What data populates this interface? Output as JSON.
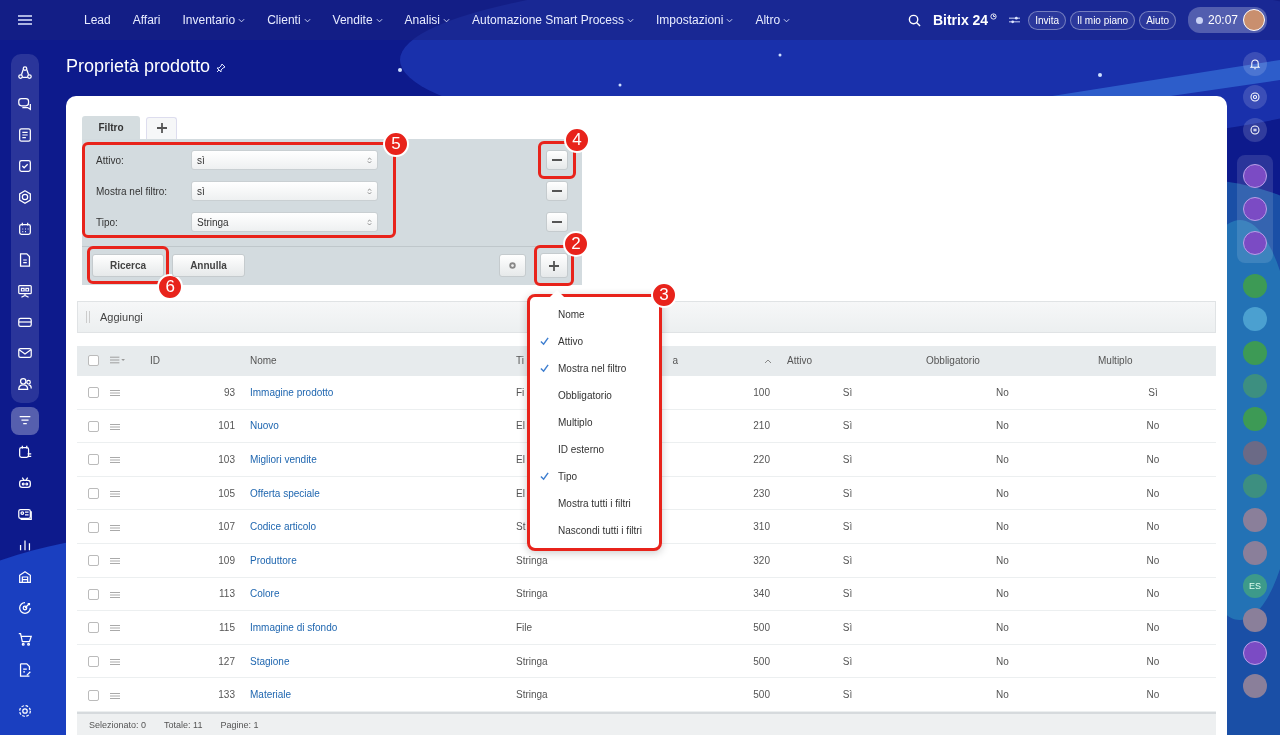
{
  "topbar": {
    "menu": [
      {
        "label": "Lead",
        "has_caret": false
      },
      {
        "label": "Affari",
        "has_caret": false
      },
      {
        "label": "Inventario",
        "has_caret": true
      },
      {
        "label": "Clienti",
        "has_caret": true
      },
      {
        "label": "Vendite",
        "has_caret": true
      },
      {
        "label": "Analisi",
        "has_caret": true
      },
      {
        "label": "Automazione Smart Process",
        "has_caret": true
      },
      {
        "label": "Impostazioni",
        "has_caret": true
      },
      {
        "label": "Altro",
        "has_caret": true
      }
    ],
    "brand": "Bitrix 24",
    "buttons": [
      "Invita",
      "Il mio piano",
      "Aiuto"
    ],
    "time": "20:07"
  },
  "sidebar": {
    "items": [
      {
        "selected": false
      },
      {
        "selected": false
      },
      {
        "selected": false
      },
      {
        "selected": false
      },
      {
        "selected": false
      },
      {
        "selected": false
      },
      {
        "selected": false
      },
      {
        "selected": false
      },
      {
        "selected": false
      },
      {
        "selected": false
      },
      {
        "selected": false
      },
      {
        "selected": true
      },
      {
        "selected": false
      },
      {
        "selected": false
      },
      {
        "selected": false
      },
      {
        "selected": false
      },
      {
        "selected": false
      },
      {
        "selected": false
      },
      {
        "selected": false
      },
      {
        "selected": false
      }
    ]
  },
  "page": {
    "title": "Proprietà prodotto"
  },
  "filter": {
    "tab": {
      "label": "Filtro",
      "selected": true
    },
    "callout": "5",
    "fields": [
      {
        "label": "Attivo:",
        "value": "sì",
        "callout": "4"
      },
      {
        "label": "Mostra nel filtro:",
        "value": "sì"
      },
      {
        "label": "Tipo:",
        "value": "Stringa"
      }
    ],
    "buttons": [
      {
        "label": "Ricerca",
        "callout": "6"
      },
      {
        "label": "Annulla"
      }
    ],
    "add_callout": "2"
  },
  "field_menu": {
    "callout": "3",
    "items": [
      {
        "label": "Nome",
        "checked": false
      },
      {
        "label": "Attivo",
        "checked": true
      },
      {
        "label": "Mostra nel filtro",
        "checked": true
      },
      {
        "label": "Obbligatorio",
        "checked": false
      },
      {
        "label": "Multiplo",
        "checked": false
      },
      {
        "label": "ID esterno",
        "checked": false
      },
      {
        "label": "Tipo",
        "checked": true
      },
      {
        "label": "Mostra tutti i filtri",
        "checked": false
      },
      {
        "label": "Nascondi tutti i filtri",
        "checked": false
      }
    ]
  },
  "toolbar": {
    "label": "Aggiungi"
  },
  "table": {
    "select_all": {
      "checked": false
    },
    "columns": [
      "ID",
      "Nome",
      "Ti",
      "a",
      "Attivo",
      "Obbligatorio",
      "Multiplo"
    ],
    "rows": [
      {
        "id": "93",
        "name": "Immagine prodotto",
        "type": "Fi",
        "sort": "100",
        "active": "Sì",
        "required": "No",
        "multiple": "Sì",
        "selected": false
      },
      {
        "id": "101",
        "name": "Nuovo",
        "type": "El",
        "sort": "210",
        "active": "Sì",
        "required": "No",
        "multiple": "No",
        "selected": false
      },
      {
        "id": "103",
        "name": "Migliori vendite",
        "type": "El",
        "sort": "220",
        "active": "Sì",
        "required": "No",
        "multiple": "No",
        "selected": false
      },
      {
        "id": "105",
        "name": "Offerta speciale",
        "type": "El",
        "sort": "230",
        "active": "Sì",
        "required": "No",
        "multiple": "No",
        "selected": false
      },
      {
        "id": "107",
        "name": "Codice articolo",
        "type": "St",
        "sort": "310",
        "active": "Sì",
        "required": "No",
        "multiple": "No",
        "selected": false
      },
      {
        "id": "109",
        "name": "Produttore",
        "type": "Stringa",
        "sort": "320",
        "active": "Sì",
        "required": "No",
        "multiple": "No",
        "selected": false
      },
      {
        "id": "113",
        "name": "Colore",
        "type": "Stringa",
        "sort": "340",
        "active": "Sì",
        "required": "No",
        "multiple": "No",
        "selected": false
      },
      {
        "id": "115",
        "name": "Immagine di sfondo",
        "type": "File",
        "sort": "500",
        "active": "Sì",
        "required": "No",
        "multiple": "No",
        "selected": false
      },
      {
        "id": "127",
        "name": "Stagione",
        "type": "Stringa",
        "sort": "500",
        "active": "Sì",
        "required": "No",
        "multiple": "No",
        "selected": false
      },
      {
        "id": "133",
        "name": "Materiale",
        "type": "Stringa",
        "sort": "500",
        "active": "Sì",
        "required": "No",
        "multiple": "No",
        "selected": false
      }
    ]
  },
  "footer": {
    "items": [
      "Selezionato: 0",
      "Totale: 11",
      "Pagine: 1"
    ]
  },
  "right_panel": {
    "initials": "ES"
  }
}
